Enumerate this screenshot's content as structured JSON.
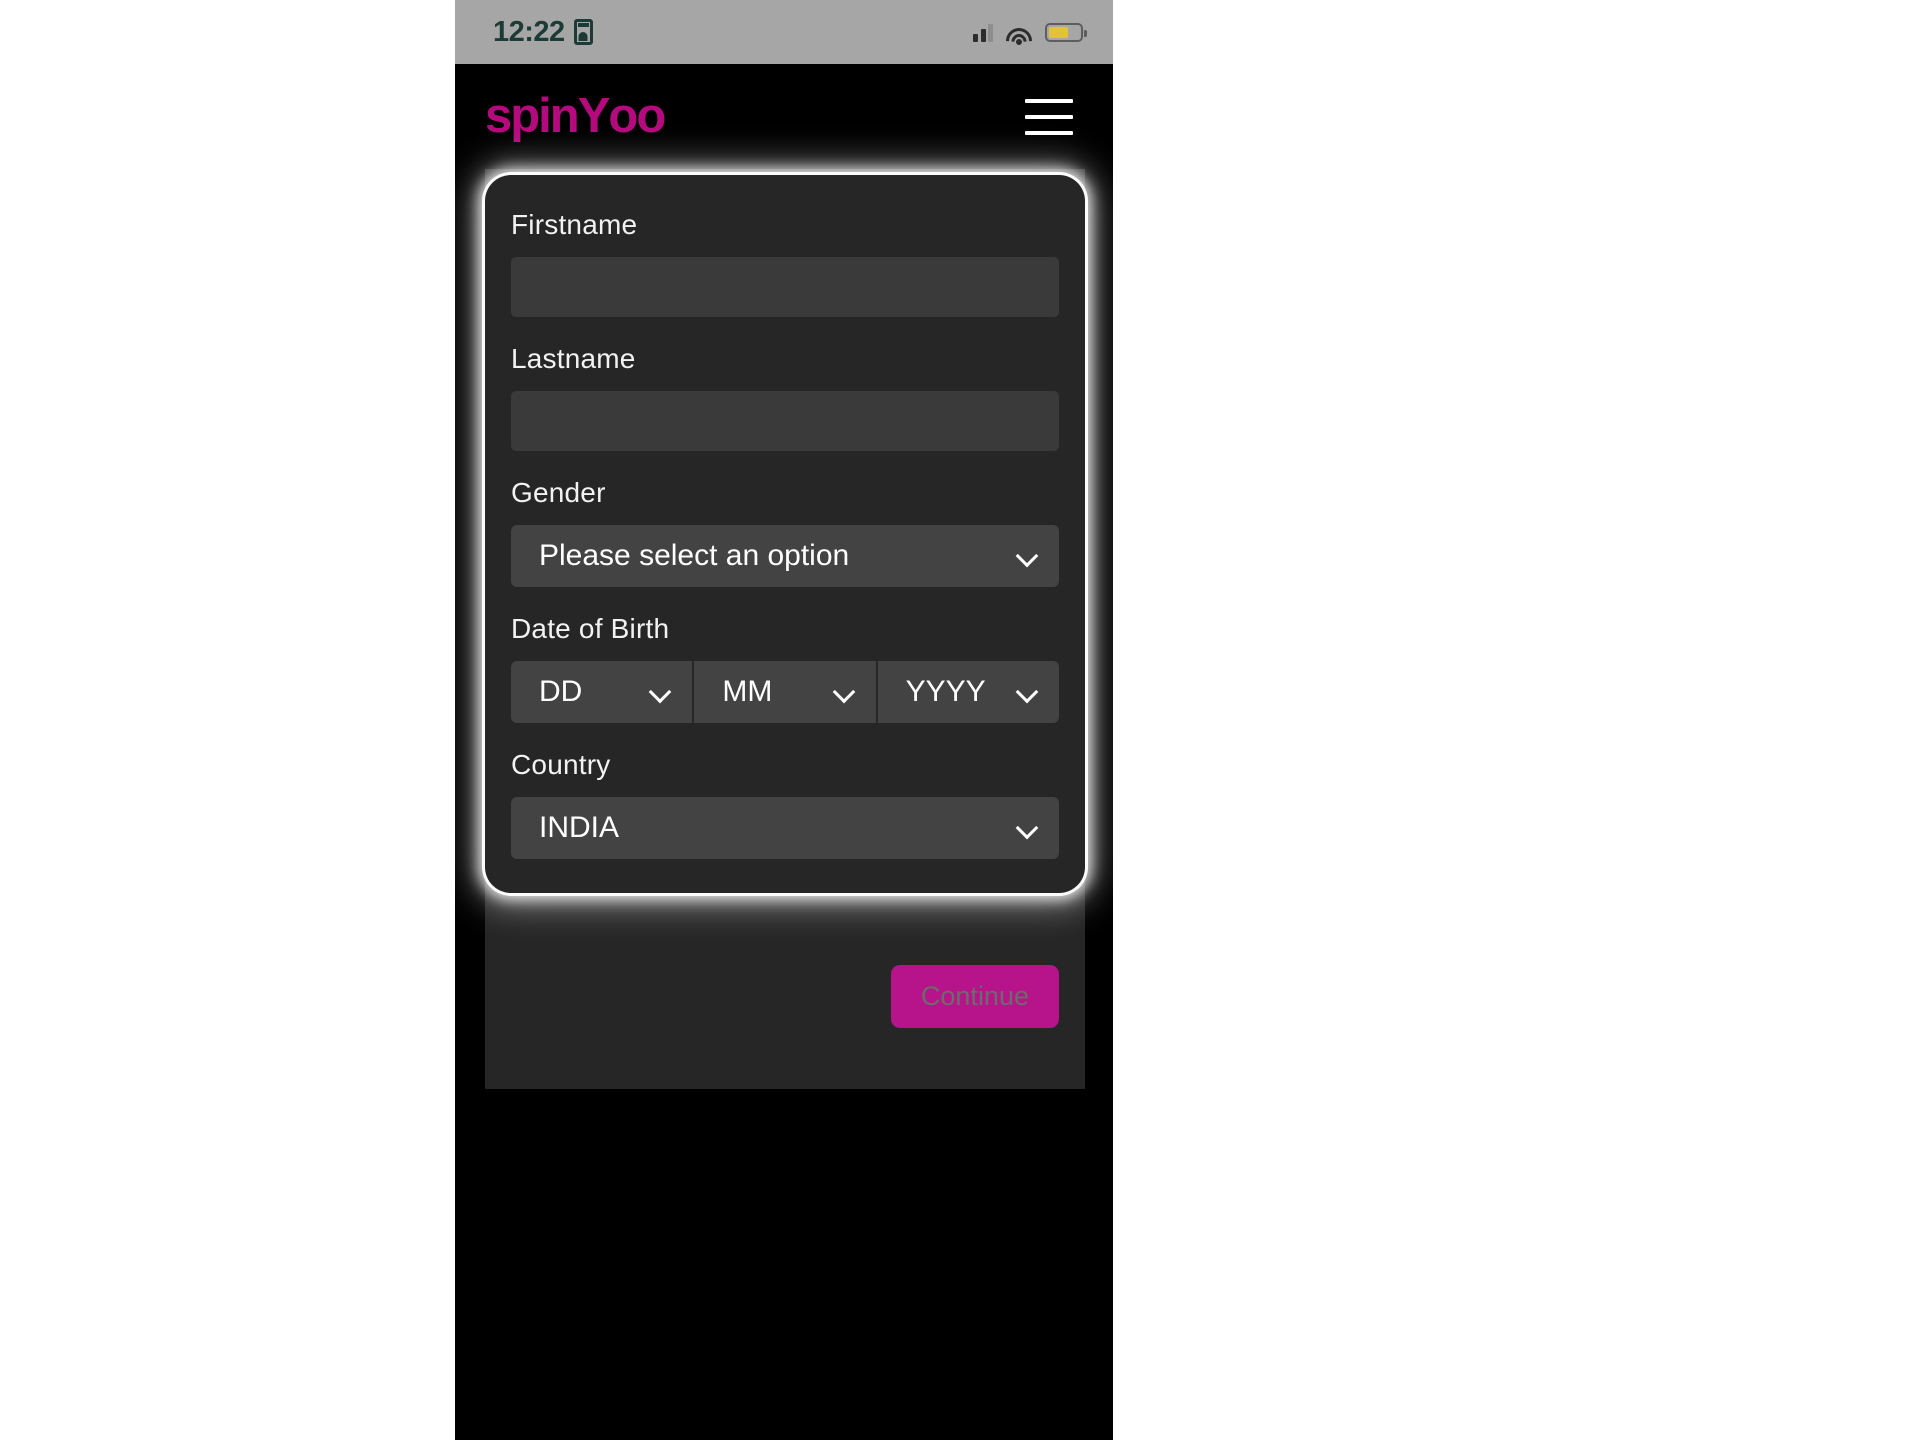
{
  "status_bar": {
    "time": "12:22",
    "sim_icon": "sim-card-icon",
    "signal_icon": "cellular-signal-icon",
    "wifi_icon": "wifi-icon",
    "battery_icon": "battery-icon",
    "battery_color": "#e2c337"
  },
  "app_bar": {
    "brand_part1": "spin",
    "brand_part2": "Y",
    "brand_part3": "oo",
    "brand_color": "#b50a7e",
    "menu_icon": "hamburger-menu-icon"
  },
  "form": {
    "firstname": {
      "label": "Firstname",
      "value": "",
      "placeholder": ""
    },
    "lastname": {
      "label": "Lastname",
      "value": "",
      "placeholder": ""
    },
    "gender": {
      "label": "Gender",
      "value": "Please select an option",
      "chevron_icon": "chevron-down-icon"
    },
    "date_of_birth": {
      "label": "Date of Birth",
      "day": "DD",
      "month": "MM",
      "year": "YYYY",
      "chevron_icon": "chevron-down-icon"
    },
    "country": {
      "label": "Country",
      "value": "INDIA",
      "chevron_icon": "chevron-down-icon"
    }
  },
  "actions": {
    "continue_label": "Continue",
    "continue_color": "#b7138a"
  }
}
